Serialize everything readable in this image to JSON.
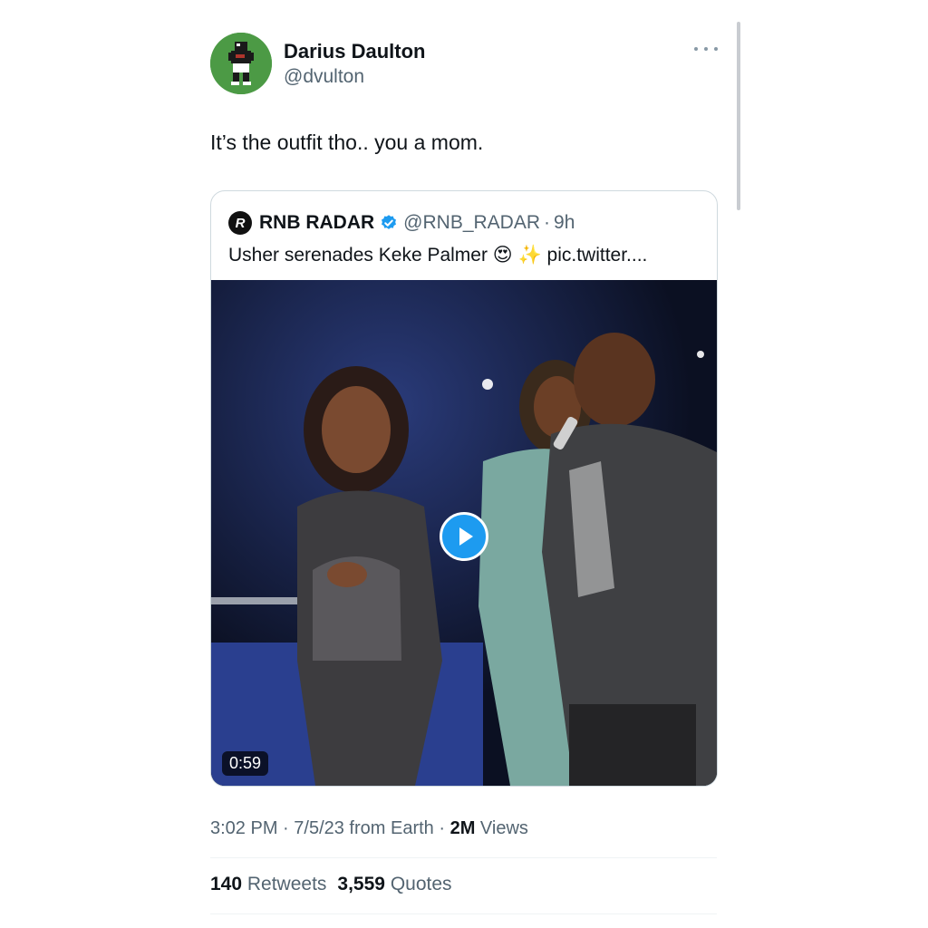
{
  "tweet": {
    "author_name": "Darius Daulton",
    "author_handle": "@dvulton",
    "text": "It’s the outfit tho.. you a mom.",
    "avatar_icon": "pixel-football-player-icon",
    "avatar_color": "#4c9a45"
  },
  "quoted": {
    "name": "RNB RADAR",
    "verified_icon": "verified-badge-icon",
    "verified_color": "#1d9bf0",
    "handle": "@RNB_RADAR",
    "separator": "·",
    "time": "9h",
    "text": "Usher serenades Keke Palmer 😍 ✨  pic.twitter....",
    "avatar_letter": "R",
    "video_duration": "0:59"
  },
  "meta": {
    "time": "3:02 PM",
    "separator": " · ",
    "date": "7/5/23",
    "source": " from Earth",
    "separator2": " · ",
    "views_count": "2M",
    "views_label": " Views"
  },
  "stats": {
    "retweets_count": "140",
    "retweets_label": " Retweets",
    "quotes_count": "3,559",
    "quotes_label": " Quotes"
  }
}
